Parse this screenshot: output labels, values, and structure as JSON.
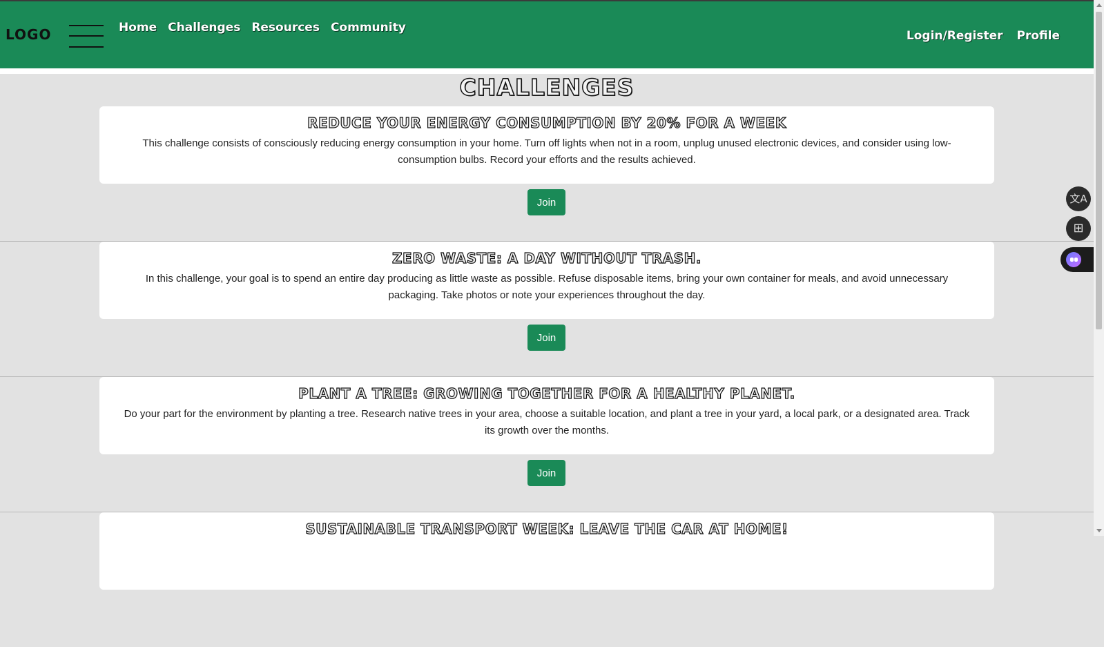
{
  "header": {
    "logo": "LOGO",
    "nav": [
      "Home",
      "Challenges",
      "Resources",
      "Community"
    ],
    "right_nav": [
      "Login/Register",
      "Profile"
    ],
    "brand_color": "#1a8a57"
  },
  "main": {
    "title": "CHALLENGES",
    "challenges": [
      {
        "title": "REDUCE YOUR ENERGY CONSUMPTION BY 20% FOR A WEEK",
        "description": "This challenge consists of consciously reducing energy consumption in your home. Turn off lights when not in a room, unplug unused electronic devices, and consider using low-consumption bulbs. Record your efforts and the results achieved.",
        "button": "Join"
      },
      {
        "title": "ZERO WASTE: A DAY WITHOUT TRASH.",
        "description": "In this challenge, your goal is to spend an entire day producing as little waste as possible. Refuse disposable items, bring your own container for meals, and avoid unnecessary packaging. Take photos or note your experiences throughout the day.",
        "button": "Join"
      },
      {
        "title": "PLANT A TREE: GROWING TOGETHER FOR A HEALTHY PLANET.",
        "description": "Do your part for the environment by planting a tree. Research native trees in your area, choose a suitable location, and plant a tree in your yard, a local park, or a designated area. Track its growth over the months.",
        "button": "Join"
      },
      {
        "title": "SUSTAINABLE TRANSPORT WEEK: LEAVE THE CAR AT HOME!",
        "description": "",
        "button": ""
      }
    ]
  },
  "side_tools": {
    "icons": [
      "translate-icon",
      "apps-icon",
      "assistant-icon"
    ],
    "translate_glyph": "文A",
    "apps_glyph": "⊞"
  }
}
